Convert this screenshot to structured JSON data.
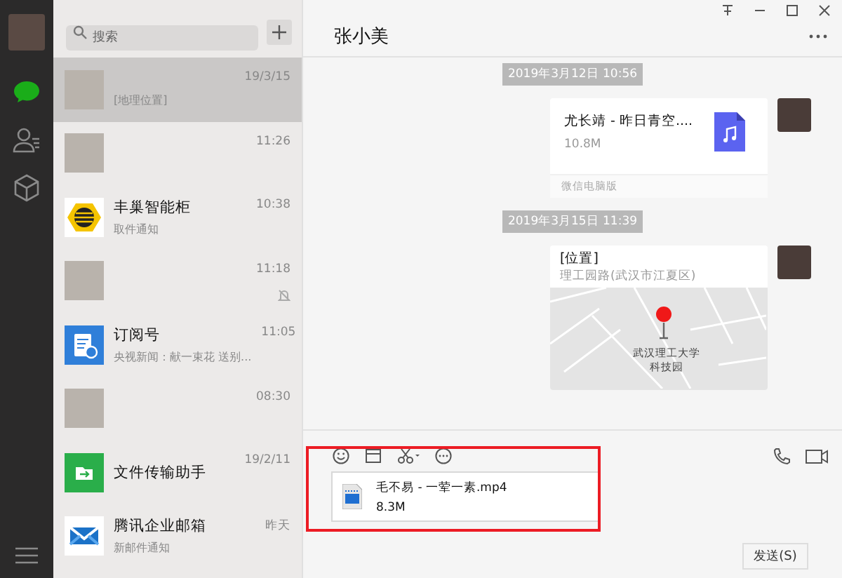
{
  "sidebar": {
    "nav": [
      {
        "kind": "chat",
        "selected": true
      },
      {
        "kind": "contacts",
        "selected": false
      },
      {
        "kind": "favorites",
        "selected": false
      }
    ]
  },
  "chat_list": {
    "search": {
      "placeholder": "搜索"
    },
    "rows": [
      {
        "kind": "photo",
        "preview": "[地理位置]",
        "time": "19/3/15",
        "selected": true,
        "muted": false
      },
      {
        "kind": "photo",
        "time": "11:26",
        "selected": false,
        "muted": false
      },
      {
        "kind": "locker",
        "name": "丰巢智能柜",
        "preview": "取件通知",
        "time": "10:38",
        "selected": false,
        "muted": false
      },
      {
        "kind": "photo",
        "time": "11:18",
        "selected": false,
        "muted": true
      },
      {
        "kind": "subscription",
        "name": "订阅号",
        "preview": "央视新闻：献一束花 送别...",
        "time": "11:05",
        "selected": false,
        "muted": false
      },
      {
        "kind": "photo",
        "time": "08:30",
        "selected": false,
        "muted": false
      },
      {
        "kind": "file-transfer",
        "name": "文件传输助手",
        "time": "19/2/11",
        "selected": false,
        "muted": false
      },
      {
        "kind": "mail",
        "name": "腾讯企业邮箱",
        "preview": "新邮件通知",
        "time": "昨天",
        "selected": false,
        "muted": false
      }
    ]
  },
  "chat": {
    "title": "张小美",
    "messages": [
      {
        "kind": "timestamp",
        "text": "2019年3月12日 10:56"
      },
      {
        "kind": "file",
        "name": "尤长靖 - 昨日青空....",
        "size": "10.8M",
        "source": "微信电脑版"
      },
      {
        "kind": "timestamp",
        "text": "2019年3月15日 11:39"
      },
      {
        "kind": "location",
        "title": "[位置]",
        "address": "理工园路(武汉市江夏区)",
        "map_label": "武汉理工大学科技园"
      }
    ]
  },
  "composer": {
    "attachment": {
      "name": "毛不易 - 一荤一素.mp4",
      "size": "8.3M"
    },
    "send": "发送(S)"
  }
}
